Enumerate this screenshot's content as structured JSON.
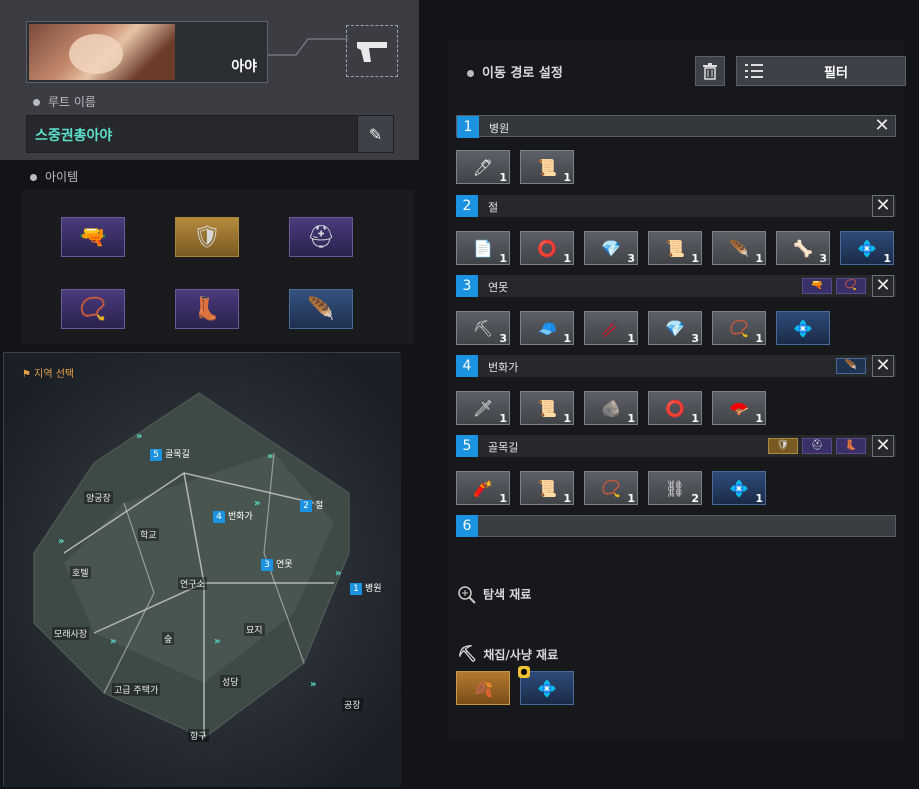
{
  "character": {
    "name": "아야",
    "weapon_icon": "pistol-icon"
  },
  "route_name": {
    "label": "루트 이름",
    "value": "스중권총아야"
  },
  "items_section": {
    "label": "아이템",
    "slots": [
      {
        "icon": "🔫",
        "name": "pistol"
      },
      {
        "icon": "🛡",
        "name": "chest-armor"
      },
      {
        "icon": "⛑",
        "name": "helmet"
      },
      {
        "icon": "📿",
        "name": "bracelet"
      },
      {
        "icon": "👢",
        "name": "boots"
      },
      {
        "icon": "🪶",
        "name": "feather-accessory"
      }
    ]
  },
  "map": {
    "label": "지역 선택",
    "places": [
      "양궁장",
      "학교",
      "호텔",
      "모래사장",
      "숲",
      "고급 주택가",
      "성당",
      "항구",
      "공장",
      "연구소",
      "묘지"
    ],
    "markers": [
      {
        "num": "1",
        "name": "병원"
      },
      {
        "num": "2",
        "name": "절"
      },
      {
        "num": "3",
        "name": "연못"
      },
      {
        "num": "4",
        "name": "번화가"
      },
      {
        "num": "5",
        "name": "골목길"
      }
    ]
  },
  "route": {
    "title": "이동 경로 설정",
    "filter_label": "필터",
    "zones": [
      {
        "num": "1",
        "name": "병원",
        "items": [
          {
            "icon": "🖊",
            "count": "1"
          },
          {
            "icon": "📜",
            "count": "1"
          }
        ]
      },
      {
        "num": "2",
        "name": "절",
        "items": [
          {
            "icon": "📄",
            "count": "1"
          },
          {
            "icon": "⭕",
            "count": "1"
          },
          {
            "icon": "💎",
            "count": "3"
          },
          {
            "icon": "📜",
            "count": "1"
          },
          {
            "icon": "🪶",
            "count": "1"
          },
          {
            "icon": "🦴",
            "count": "3"
          },
          {
            "icon": "💠",
            "count": "1"
          }
        ]
      },
      {
        "num": "3",
        "name": "연못",
        "items": [
          {
            "icon": "⛏",
            "count": "3"
          },
          {
            "icon": "🧢",
            "count": "1"
          },
          {
            "icon": "🥢",
            "count": "1"
          },
          {
            "icon": "💎",
            "count": "3"
          },
          {
            "icon": "📿",
            "count": "1"
          },
          {
            "icon": "💠",
            "count": ""
          }
        ]
      },
      {
        "num": "4",
        "name": "번화가",
        "items": [
          {
            "icon": "🗡",
            "count": "1"
          },
          {
            "icon": "📜",
            "count": "1"
          },
          {
            "icon": "🪨",
            "count": "1"
          },
          {
            "icon": "⭕",
            "count": "1"
          },
          {
            "icon": "🪭",
            "count": "1"
          }
        ]
      },
      {
        "num": "5",
        "name": "골목길",
        "items": [
          {
            "icon": "🧨",
            "count": "1"
          },
          {
            "icon": "📜",
            "count": "1"
          },
          {
            "icon": "📿",
            "count": "1"
          },
          {
            "icon": "⛓",
            "count": "2"
          },
          {
            "icon": "💠",
            "count": "1"
          }
        ]
      },
      {
        "num": "6",
        "name": ""
      }
    ],
    "search_materials_label": "탐색 재료",
    "gather_label": "채집/사냥 재료",
    "gather_items": [
      {
        "icon": "🍂"
      },
      {
        "icon": "💠"
      }
    ]
  },
  "colors": {
    "accent": "#1b93e0",
    "route_name": "#5ce0cc",
    "map_label": "#e8a34a"
  }
}
